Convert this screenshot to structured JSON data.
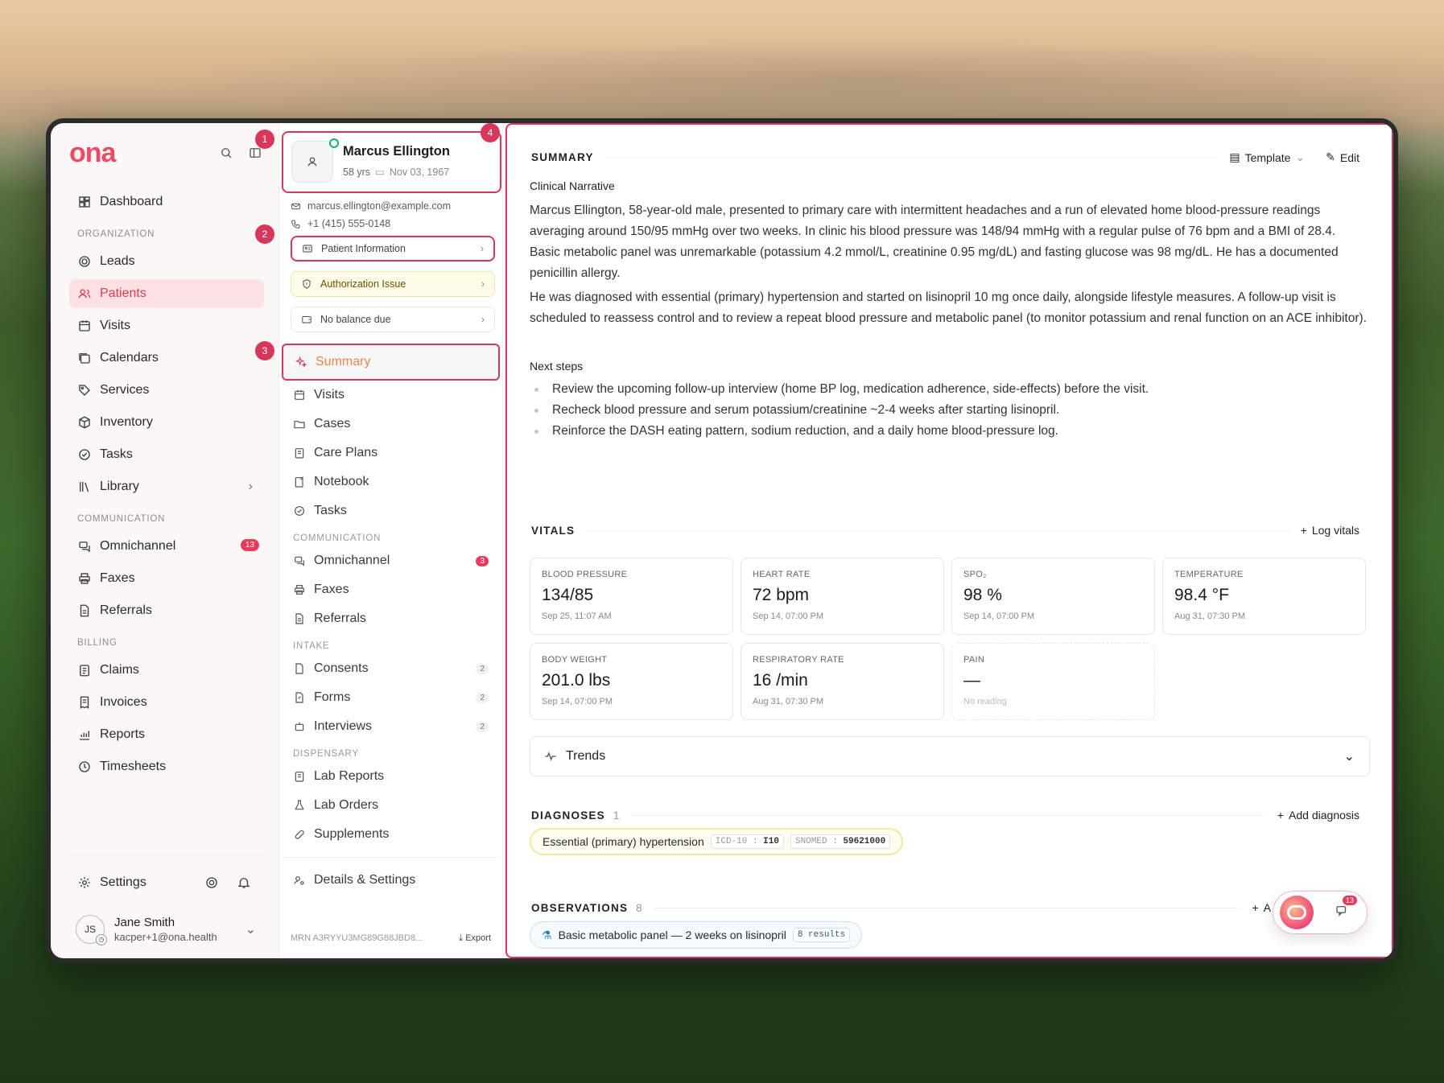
{
  "app": {
    "logo": "ona"
  },
  "sidebar": {
    "dashboard": "Dashboard",
    "sections": {
      "organization": "ORGANIZATION",
      "communication": "COMMUNICATION",
      "billing": "BILLING"
    },
    "org_items": [
      "Leads",
      "Patients",
      "Visits",
      "Calendars",
      "Services",
      "Inventory",
      "Tasks",
      "Library"
    ],
    "comm_items": [
      "Omnichannel",
      "Faxes",
      "Referrals"
    ],
    "omnichannel_badge": "13",
    "billing_items": [
      "Claims",
      "Invoices",
      "Reports",
      "Timesheets"
    ],
    "settings": "Settings",
    "user": {
      "initials": "JS",
      "name": "Jane Smith",
      "email": "kacper+1@ona.health"
    }
  },
  "markers": [
    "1",
    "2",
    "3",
    "4"
  ],
  "patient": {
    "name": "Marcus Ellington",
    "age": "58 yrs",
    "dob": "Nov 03, 1967",
    "email": "marcus.ellington@example.com",
    "phone": "+1 (415) 555-0148",
    "buttons": {
      "info": "Patient Information",
      "auth": "Authorization Issue",
      "balance": "No balance due"
    }
  },
  "midnav": {
    "summary": "Summary",
    "visits": "Visits",
    "cases": "Cases",
    "care_plans": "Care Plans",
    "notebook": "Notebook",
    "tasks": "Tasks",
    "communication": "COMMUNICATION",
    "omnichannel": "Omnichannel",
    "omnichannel_count": "3",
    "faxes": "Faxes",
    "referrals": "Referrals",
    "intake": "INTAKE",
    "consents": "Consents",
    "consents_count": "2",
    "forms": "Forms",
    "forms_count": "2",
    "interviews": "Interviews",
    "interviews_count": "2",
    "dispensary": "DISPENSARY",
    "lab_reports": "Lab Reports",
    "lab_orders": "Lab Orders",
    "supplements": "Supplements",
    "details": "Details & Settings",
    "mrn": "MRN A3RYYU3MG89G88JBD8...",
    "export": "Export"
  },
  "summary": {
    "heading": "SUMMARY",
    "template": "Template",
    "edit": "Edit",
    "narrative_title": "Clinical Narrative",
    "para1": "Marcus Ellington, 58-year-old male, presented to primary care with intermittent headaches and a run of elevated home blood-pressure readings averaging around 150/95 mmHg over two weeks. In clinic his blood pressure was 148/94 mmHg with a regular pulse of 76 bpm and a BMI of 28.4. Basic metabolic panel was unremarkable (potassium 4.2 mmol/L, creatinine 0.95 mg/dL) and fasting glucose was 98 mg/dL. He has a documented penicillin allergy.",
    "para2": "He was diagnosed with essential (primary) hypertension and started on lisinopril 10 mg once daily, alongside lifestyle measures. A follow-up visit is scheduled to reassess control and to review a repeat blood pressure and metabolic panel (to monitor potassium and renal function on an ACE inhibitor).",
    "next_title": "Next steps",
    "steps": [
      "Review the upcoming follow-up interview (home BP log, medication adherence, side-effects) before the visit.",
      "Recheck blood pressure and serum potassium/creatinine ~2-4 weeks after starting lisinopril.",
      "Reinforce the DASH eating pattern, sodium reduction, and a daily home blood-pressure log."
    ]
  },
  "vitals": {
    "heading": "VITALS",
    "log": "Log vitals",
    "cards": [
      {
        "label": "BLOOD PRESSURE",
        "value": "134/85",
        "time": "Sep 25, 11:07 AM"
      },
      {
        "label": "HEART RATE",
        "value": "72 bpm",
        "time": "Sep 14, 07:00 PM"
      },
      {
        "label": "SPO₂",
        "value": "98 %",
        "time": "Sep 14, 07:00 PM"
      },
      {
        "label": "TEMPERATURE",
        "value": "98.4 °F",
        "time": "Aug 31, 07:30 PM"
      },
      {
        "label": "BODY WEIGHT",
        "value": "201.0 lbs",
        "time": "Sep 14, 07:00 PM"
      },
      {
        "label": "RESPIRATORY RATE",
        "value": "16 /min",
        "time": "Aug 31, 07:30 PM"
      },
      {
        "label": "PAIN",
        "value": "—",
        "time": "No reading"
      }
    ],
    "trends": "Trends"
  },
  "diagnoses": {
    "heading": "DIAGNOSES",
    "count": "1",
    "add": "Add diagnosis",
    "item": "Essential (primary) hypertension",
    "icd_key": "ICD-10",
    "icd_val": "I10",
    "snomed_key": "SNOMED",
    "snomed_val": "59621000"
  },
  "observations": {
    "heading": "OBSERVATIONS",
    "count": "8",
    "add": "A",
    "item": "Basic metabolic panel — 2 weeks on lisinopril",
    "results": "8 results"
  },
  "chat": {
    "badge": "13"
  }
}
